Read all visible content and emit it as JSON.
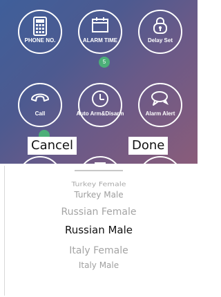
{
  "grid_buttons": [
    {
      "label": "PHONE NO.",
      "icon": "phone-keypad-icon"
    },
    {
      "label": "ALARM TIME",
      "icon": "calendar-icon",
      "badge": "5"
    },
    {
      "label": "Delay Set",
      "icon": "lock-icon"
    },
    {
      "label": "Call",
      "icon": "handset-icon"
    },
    {
      "label": "Auto Arm&Disarm",
      "icon": "clock-icon"
    },
    {
      "label": "Alarm Alert",
      "icon": "chat-bubble-icon"
    }
  ],
  "toolbar": {
    "cancel_label": "Cancel",
    "done_label": "Done"
  },
  "picker": {
    "options": [
      "Turkey Female",
      "Turkey Male",
      "Russian Female",
      "Russian Male",
      "Italy Female",
      "Italy Male"
    ],
    "selected": "Russian Male"
  },
  "colors": {
    "accent_badge": "#4caf78",
    "background_gradient_start": "#3f5f9a",
    "background_gradient_end": "#8a5c7a"
  }
}
